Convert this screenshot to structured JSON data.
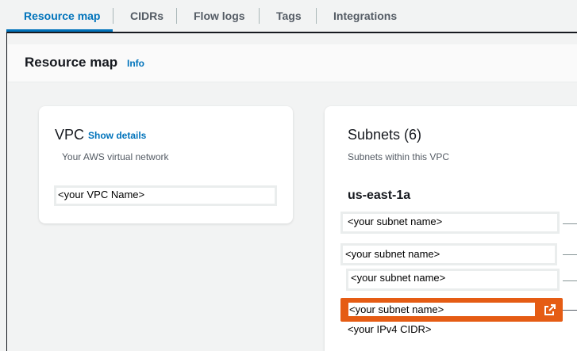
{
  "tabs": [
    {
      "label": "Resource map",
      "active": true
    },
    {
      "label": "CIDRs",
      "active": false
    },
    {
      "label": "Flow logs",
      "active": false
    },
    {
      "label": "Tags",
      "active": false
    },
    {
      "label": "Integrations",
      "active": false
    }
  ],
  "header": {
    "title": "Resource map",
    "info_label": "Info"
  },
  "vpc": {
    "title": "VPC",
    "show_details_label": "Show details",
    "description": "Your AWS virtual network",
    "name": "<your VPC Name>"
  },
  "subnets": {
    "title": "Subnets (6)",
    "description": "Subnets within this VPC",
    "az": "us-east-1a",
    "items": [
      {
        "name": "<your subnet name>"
      },
      {
        "name": "<your subnet name>"
      },
      {
        "name": "<your subnet name>"
      },
      {
        "name": "<your subnet name>",
        "selected": true,
        "cidr": "<your IPv4 CIDR>"
      }
    ]
  },
  "icons": {
    "external_link": "external-link-icon"
  },
  "colors": {
    "accent": "#0073bb",
    "selected": "#e55c14"
  }
}
